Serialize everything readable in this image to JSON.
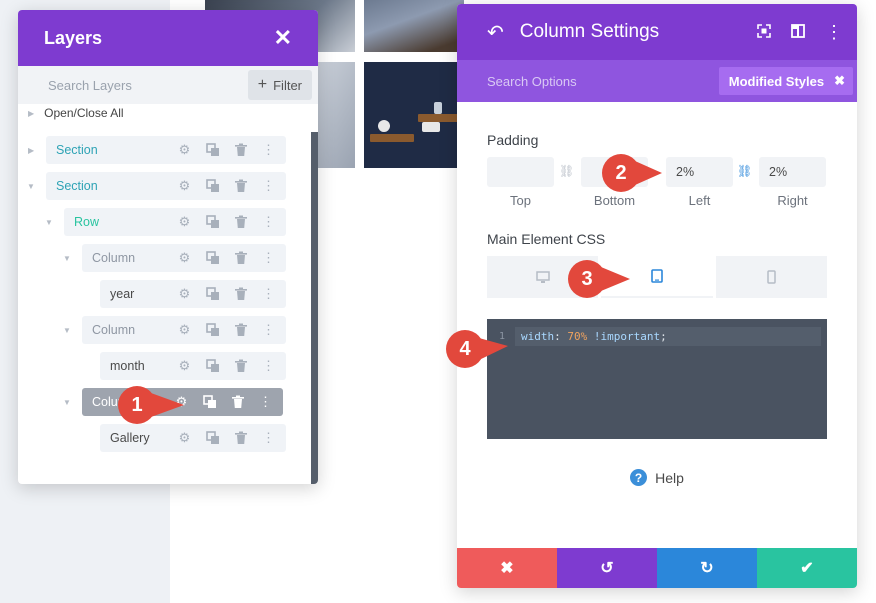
{
  "layers": {
    "title": "Layers",
    "search_placeholder": "Search Layers",
    "filter_label": "Filter",
    "open_close_all": "Open/Close All",
    "items": [
      {
        "label": "Section"
      },
      {
        "label": "Section"
      },
      {
        "label": "Row"
      },
      {
        "label": "Column"
      },
      {
        "label": "year"
      },
      {
        "label": "Column"
      },
      {
        "label": "month"
      },
      {
        "label": "Column"
      },
      {
        "label": "Gallery"
      }
    ]
  },
  "settings": {
    "title": "Column Settings",
    "search_options": "Search Options",
    "modified_styles": "Modified Styles",
    "padding_label": "Padding",
    "padding": {
      "top": {
        "caption": "Top",
        "value": ""
      },
      "bottom": {
        "caption": "Bottom",
        "value": ""
      },
      "left": {
        "caption": "Left",
        "value": "2%"
      },
      "right": {
        "caption": "Right",
        "value": "2%"
      }
    },
    "css_label": "Main Element CSS",
    "devices": [
      "desktop",
      "tablet",
      "phone"
    ],
    "active_device": "tablet",
    "code": {
      "line_number": "1",
      "property": "width",
      "value": "70%",
      "flag": "!important"
    },
    "help_label": "Help"
  },
  "callouts": [
    "1",
    "2",
    "3",
    "4"
  ],
  "colors": {
    "header_purple": "#7e3bd0",
    "tab_purple": "#8f55df",
    "cancel_red": "#ef5b5b",
    "undo_purple": "#7e3bd0",
    "redo_blue": "#2b87da",
    "save_green": "#29c4a0",
    "callout_red": "#e2483c"
  },
  "icons": {
    "close": "close-icon",
    "back": "back-arrow-icon",
    "expand": "expand-icon",
    "split": "split-view-icon",
    "more": "more-icon",
    "help": "help-icon"
  }
}
